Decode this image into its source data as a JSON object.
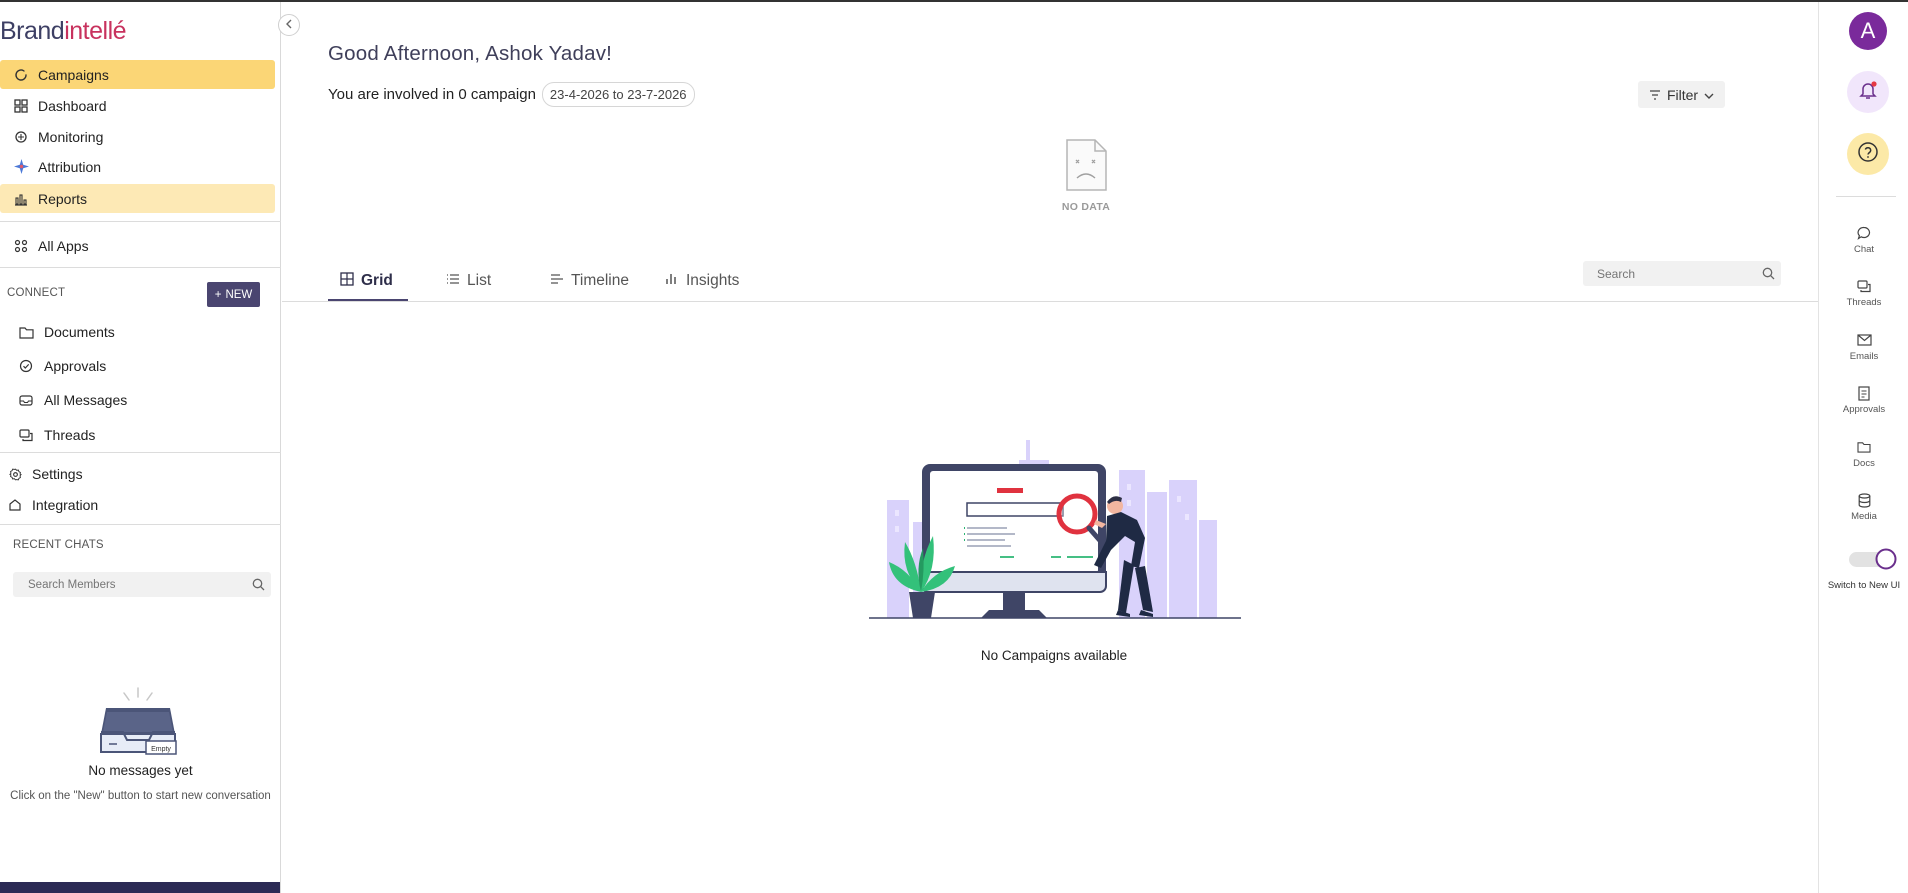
{
  "brand": {
    "part1": "Brand",
    "part2": "intellé"
  },
  "nav": {
    "items": [
      {
        "label": "Campaigns",
        "icon": "loader-icon"
      },
      {
        "label": "Dashboard",
        "icon": "dashboard-icon"
      },
      {
        "label": "Monitoring",
        "icon": "monitoring-icon"
      },
      {
        "label": "Attribution",
        "icon": "sparkle-icon"
      },
      {
        "label": "Reports",
        "icon": "bar-chart-icon"
      }
    ],
    "all_apps": "All Apps"
  },
  "connect": {
    "title": "CONNECT",
    "new_label": "NEW",
    "items": [
      {
        "label": "Documents"
      },
      {
        "label": "Approvals"
      },
      {
        "label": "All Messages"
      },
      {
        "label": "Threads"
      }
    ]
  },
  "settings": {
    "label": "Settings"
  },
  "integration": {
    "label": "Integration"
  },
  "recent_chats": {
    "title": "RECENT CHATS",
    "search_placeholder": "Search Members",
    "empty_badge": "Empty",
    "empty_title": "No messages yet",
    "empty_subtitle": "Click on the \"New\" button to start new conversation"
  },
  "header": {
    "greeting": "Good Afternoon, Ashok Yadav!",
    "involved": "You are involved in 0 campaign",
    "date_range": "23-4-2026 to 23-7-2026",
    "filter_label": "Filter",
    "no_data": "NO DATA"
  },
  "tabs": [
    {
      "label": "Grid"
    },
    {
      "label": "List"
    },
    {
      "label": "Timeline"
    },
    {
      "label": "Insights"
    }
  ],
  "search": {
    "placeholder": "Search"
  },
  "empty_state": {
    "text": "No Campaigns available"
  },
  "rail": {
    "avatar_letter": "A",
    "items": [
      {
        "label": "Chat"
      },
      {
        "label": "Threads"
      },
      {
        "label": "Emails"
      },
      {
        "label": "Approvals"
      },
      {
        "label": "Docs"
      },
      {
        "label": "Media"
      }
    ],
    "toggle_label": "Switch to New UI",
    "toggle_on": false
  },
  "colors": {
    "active_nav": "#fbd676",
    "soft_nav": "#fde9b5",
    "brand_dark": "#3d3f64",
    "brand_accent": "#c8325e",
    "new_button": "#4a4570",
    "avatar": "#7a2a9b"
  }
}
